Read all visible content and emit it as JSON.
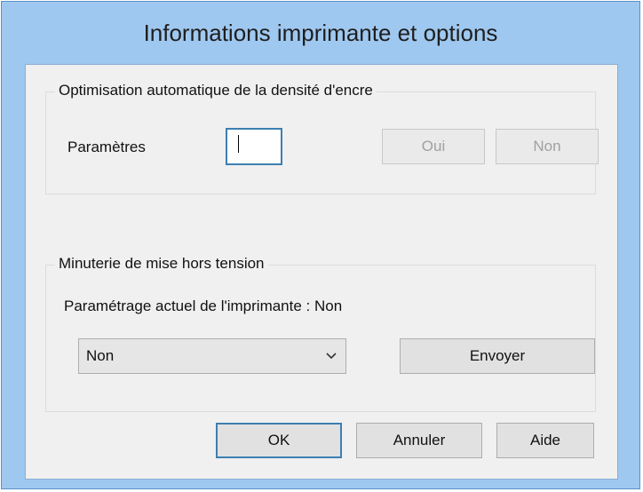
{
  "window": {
    "title": "Informations imprimante et options"
  },
  "ink_group": {
    "legend": "Optimisation automatique de la densité d'encre",
    "settings_label": "Paramètres",
    "settings_value": "",
    "yes_button": "Oui",
    "no_button": "Non"
  },
  "timer_group": {
    "legend": "Minuterie de mise hors tension",
    "current_setting": "Paramétrage actuel de l'imprimante : Non",
    "select_value": "Non",
    "send_button": "Envoyer"
  },
  "footer": {
    "ok_button": "OK",
    "cancel_button": "Annuler",
    "help_button": "Aide"
  },
  "icons": {
    "dropdown": "chevron-down-icon"
  },
  "colors": {
    "titlebar": "#9fc8f0",
    "focus_border": "#3c7fb1"
  }
}
